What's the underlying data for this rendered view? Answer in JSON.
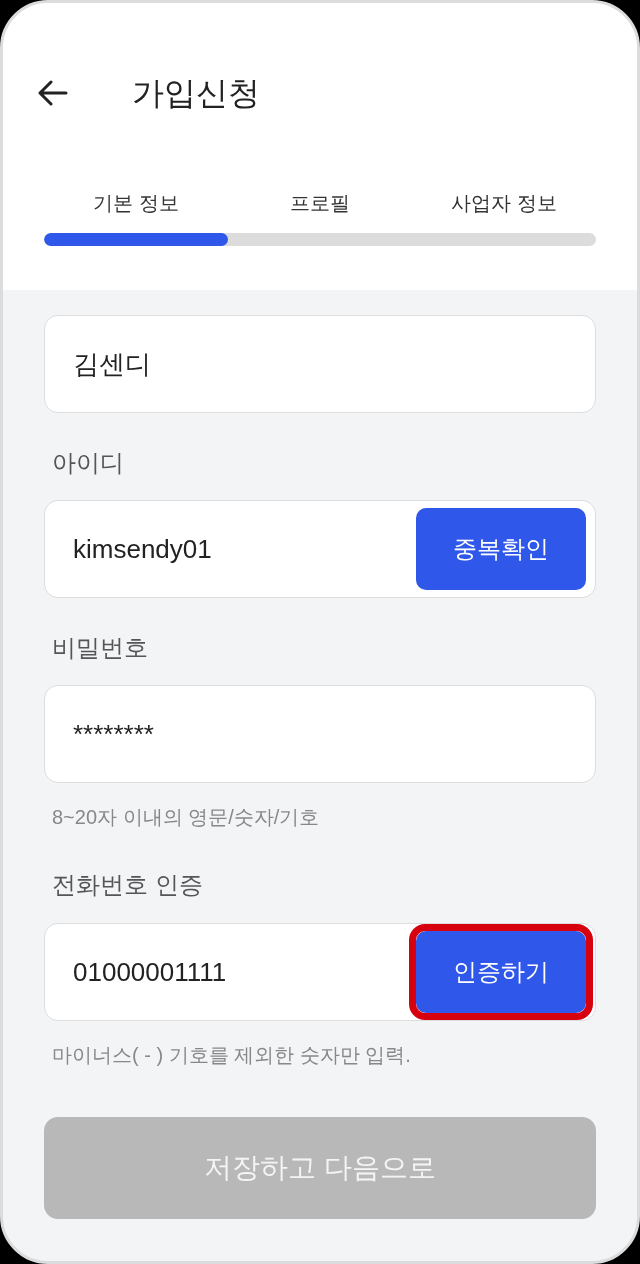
{
  "header": {
    "title": "가입신청"
  },
  "steps": [
    "기본 정보",
    "프로필",
    "사업자 정보"
  ],
  "progress": {
    "level": 0.333
  },
  "fields": [
    {
      "kind": "input",
      "value": "김센디"
    },
    {
      "kind": "input_with_button",
      "label": "아이디",
      "value": "kimsendy01",
      "button": {
        "label": "중복확인",
        "highlighted": false
      }
    },
    {
      "kind": "input",
      "label": "비밀번호",
      "value": "********",
      "hint": "8~20자 이내의 영문/숫자/기호"
    },
    {
      "kind": "input_with_button",
      "label": "전화번호 인증",
      "value": "01000001111",
      "button": {
        "label": "인증하기",
        "highlighted": true
      },
      "hint": "마이너스( - ) 기호를 제외한 숫자만 입력."
    }
  ],
  "submit": {
    "label": "저장하고 다음으로",
    "disabled": true
  }
}
